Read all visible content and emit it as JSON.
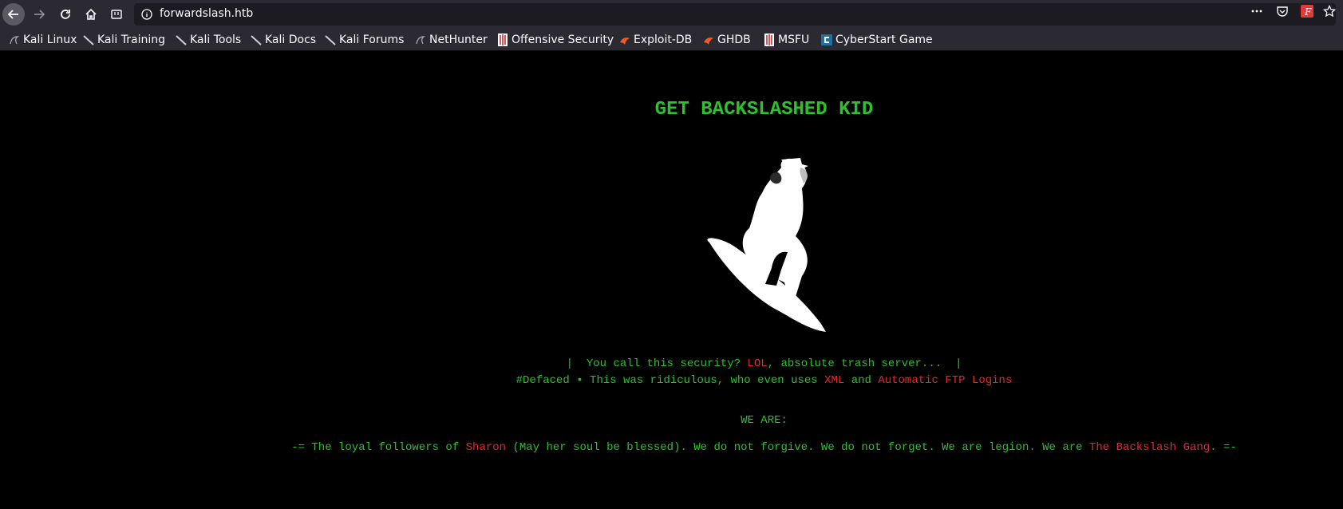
{
  "browser": {
    "url": "forwardslash.htb",
    "bookmarks": [
      {
        "label": "Kali Linux",
        "icon": "kali-dragon-icon"
      },
      {
        "label": "Kali Training",
        "icon": "kali-knife-icon"
      },
      {
        "label": "Kali Tools",
        "icon": "kali-knife-icon"
      },
      {
        "label": "Kali Docs",
        "icon": "kali-knife-icon"
      },
      {
        "label": "Kali Forums",
        "icon": "kali-knife-icon"
      },
      {
        "label": "NetHunter",
        "icon": "kali-dragon-icon"
      },
      {
        "label": "Offensive Security",
        "icon": "offsec-icon"
      },
      {
        "label": "Exploit-DB",
        "icon": "exploit-db-icon"
      },
      {
        "label": "GHDB",
        "icon": "exploit-db-icon"
      },
      {
        "label": "MSFU",
        "icon": "offsec-icon"
      },
      {
        "label": "CyberStart Game",
        "icon": "cyberstart-icon"
      }
    ]
  },
  "page": {
    "heading": "GET BACKSLASHED KID",
    "line1": {
      "pre": "|  You call this security? ",
      "red": "LOL",
      "post": ", absolute trash server...  |"
    },
    "line2": {
      "pre": "#Defaced • This was ridiculous, who even uses ",
      "red1": "XML",
      "mid": " and ",
      "red2": "Automatic FTP Logins"
    },
    "we_are": "WE ARE:",
    "line3": {
      "pre": "-= The loyal followers of ",
      "red1": "Sharon",
      "mid": " (May her soul be blessed). We do not forgive. We do not forget. We are legion. We are ",
      "red2": "The Backslash Gang",
      "post": ". =-"
    }
  },
  "colors": {
    "green": "#2fbf2f",
    "red": "#e8262b",
    "background": "#000000"
  }
}
